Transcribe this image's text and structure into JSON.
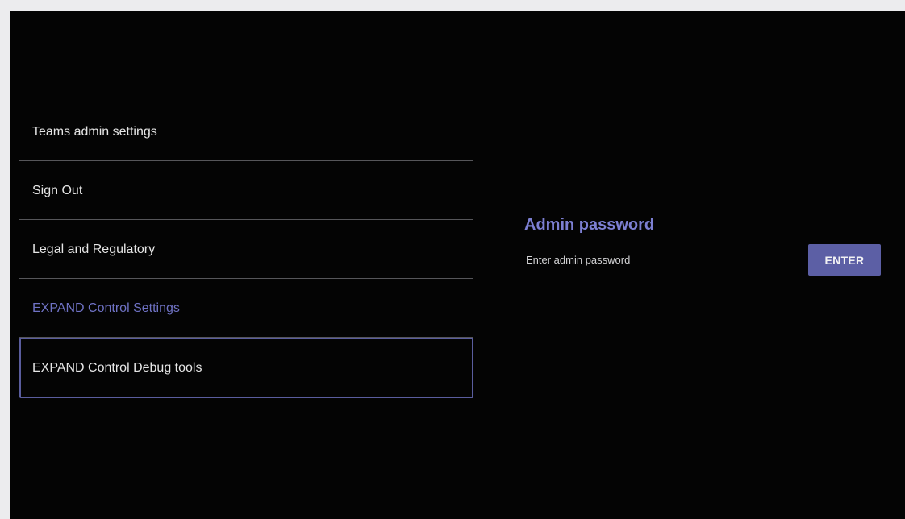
{
  "menu": {
    "items": [
      {
        "label": "Teams admin settings"
      },
      {
        "label": "Sign Out"
      },
      {
        "label": "Legal and Regulatory"
      },
      {
        "label": "EXPAND Control Settings"
      },
      {
        "label": "EXPAND Control Debug tools"
      }
    ]
  },
  "admin_panel": {
    "title": "Admin password",
    "password_placeholder": "Enter admin password",
    "password_value": "",
    "enter_label": "ENTER"
  },
  "colors": {
    "background": "#040404",
    "accent": "#6f72c4",
    "button": "#5c5fa5",
    "divider": "#56565a"
  }
}
